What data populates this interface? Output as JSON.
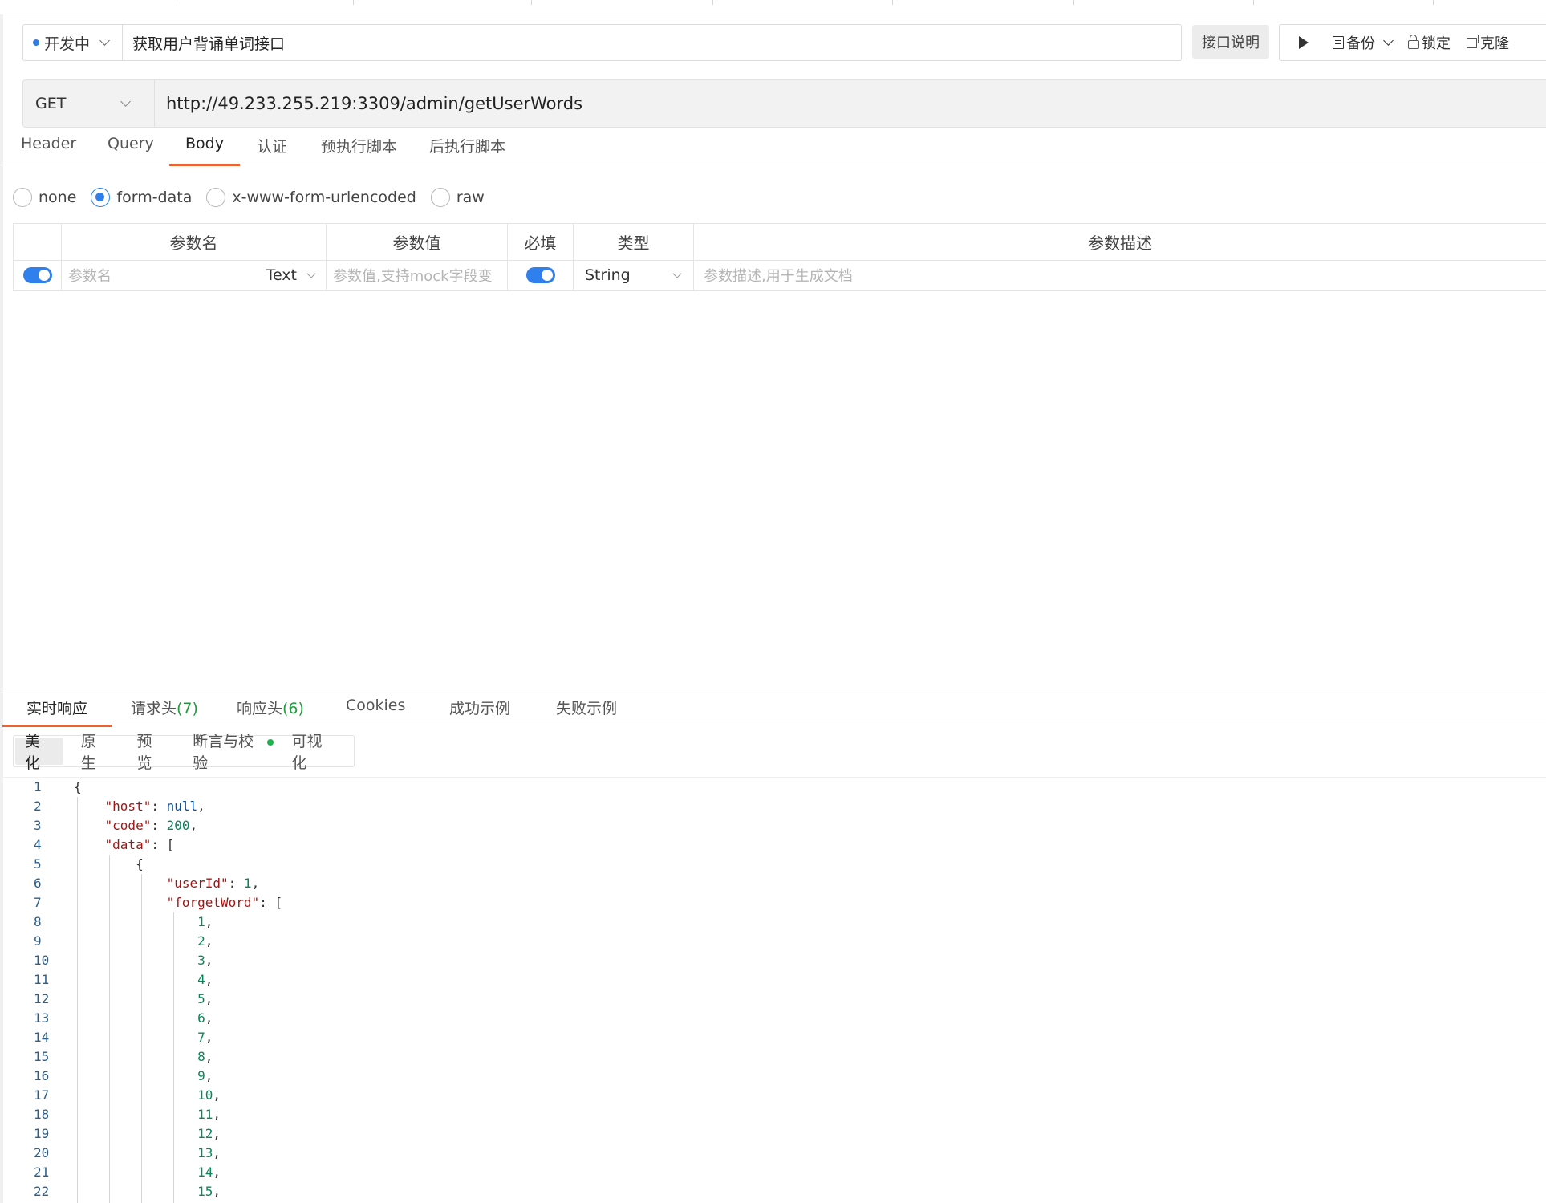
{
  "status": {
    "label": "开发中",
    "color": "#2f7de1"
  },
  "api_name": "获取用户背诵单词接口",
  "toolbar": {
    "doc_label": "接口说明",
    "run_icon": "play-icon",
    "backup_label": "备份",
    "lock_label": "锁定",
    "clone_label": "克隆"
  },
  "request": {
    "method": "GET",
    "url": "http://49.233.255.219:3309/admin/getUserWords"
  },
  "request_tabs": [
    "Header",
    "Query",
    "Body",
    "认证",
    "预执行脚本",
    "后执行脚本"
  ],
  "active_request_tab": "Body",
  "body_types": [
    "none",
    "form-data",
    "x-www-form-urlencoded",
    "raw"
  ],
  "selected_body_type": "form-data",
  "param_table": {
    "headers": [
      "参数名",
      "参数值",
      "必填",
      "类型",
      "参数描述"
    ],
    "row": {
      "name_placeholder": "参数名",
      "field_type": "Text",
      "value_placeholder": "参数值,支持mock字段变",
      "type": "String",
      "desc_placeholder": "参数描述,用于生成文档"
    }
  },
  "response_tabs": [
    {
      "label": "实时响应",
      "count": ""
    },
    {
      "label": "请求头",
      "count": "(7)"
    },
    {
      "label": "响应头",
      "count": "(6)"
    },
    {
      "label": "Cookies",
      "count": ""
    },
    {
      "label": "成功示例",
      "count": ""
    },
    {
      "label": "失败示例",
      "count": ""
    }
  ],
  "view_tabs": [
    "美化",
    "原生",
    "预览",
    "断言与校验",
    "可视化"
  ],
  "code_lines": [
    "{",
    "    \"host\": null,",
    "    \"code\": 200,",
    "    \"data\": [",
    "        {",
    "            \"userId\": 1,",
    "            \"forgetWord\": [",
    "                1,",
    "                2,",
    "                3,",
    "                4,",
    "                5,",
    "                6,",
    "                7,",
    "                8,",
    "                9,",
    "                10,",
    "                11,",
    "                12,",
    "                13,",
    "                14,",
    "                15,"
  ],
  "line_numbers": [
    "1",
    "2",
    "3",
    "4",
    "5",
    "6",
    "7",
    "8",
    "9",
    "10",
    "11",
    "12",
    "13",
    "14",
    "15",
    "16",
    "17",
    "18",
    "19",
    "20",
    "21",
    "22"
  ]
}
